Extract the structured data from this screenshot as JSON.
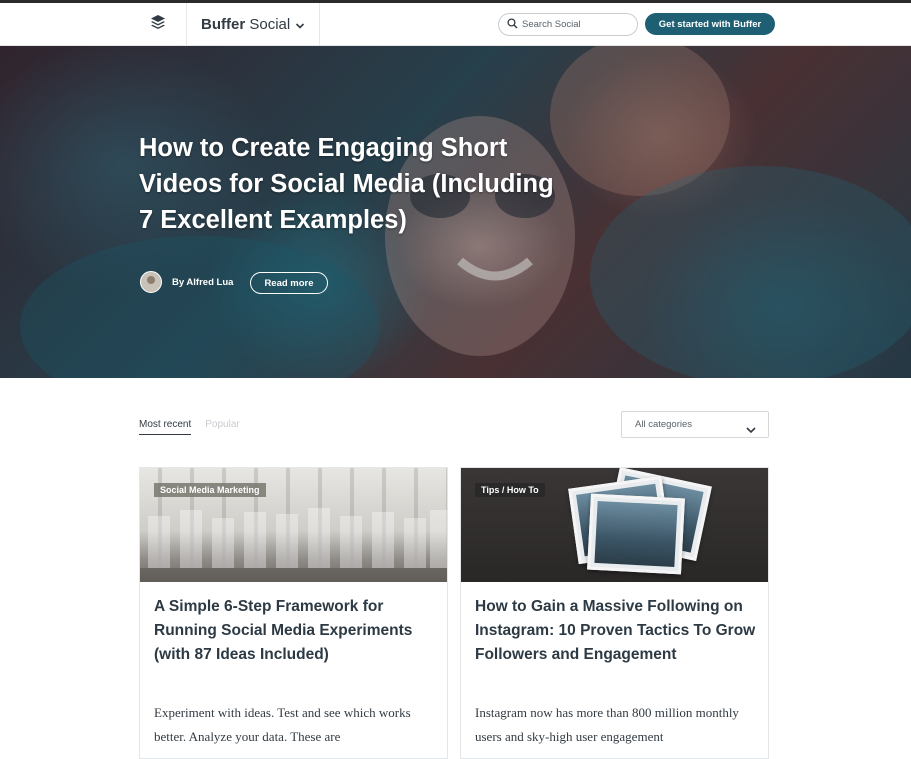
{
  "header": {
    "brand_name": "Buffer",
    "brand_suffix": "Social",
    "logo_icon": "buffer-stack-icon",
    "search_placeholder": "Search Social",
    "cta_label": "Get started with Buffer"
  },
  "hero": {
    "title": "How to Create Engaging Short Videos for Social Media (Including 7 Excellent Examples)",
    "author": "By Alfred Lua",
    "read_more_label": "Read more"
  },
  "filters": {
    "tabs": [
      {
        "label": "Most recent",
        "active": true
      },
      {
        "label": "Popular",
        "active": false
      }
    ],
    "category_selected": "All categories"
  },
  "cards": [
    {
      "category": "Social Media Marketing",
      "title": "A Simple 6-Step Framework for Running Social Media Experiments (with 87 Ideas Included)",
      "excerpt": "Experiment with ideas. Test and see which works better. Analyze your data. These are"
    },
    {
      "category": "Tips / How To",
      "title": "How to Gain a Massive Following on Instagram: 10 Proven Tactics To Grow Followers and Engagement",
      "excerpt": "Instagram now has more than 800 million monthly users and sky-high user engagement"
    }
  ],
  "colors": {
    "cta_background": "#1f5f73",
    "text": "#323b43",
    "inactive_tab": "#c8ccd0"
  }
}
